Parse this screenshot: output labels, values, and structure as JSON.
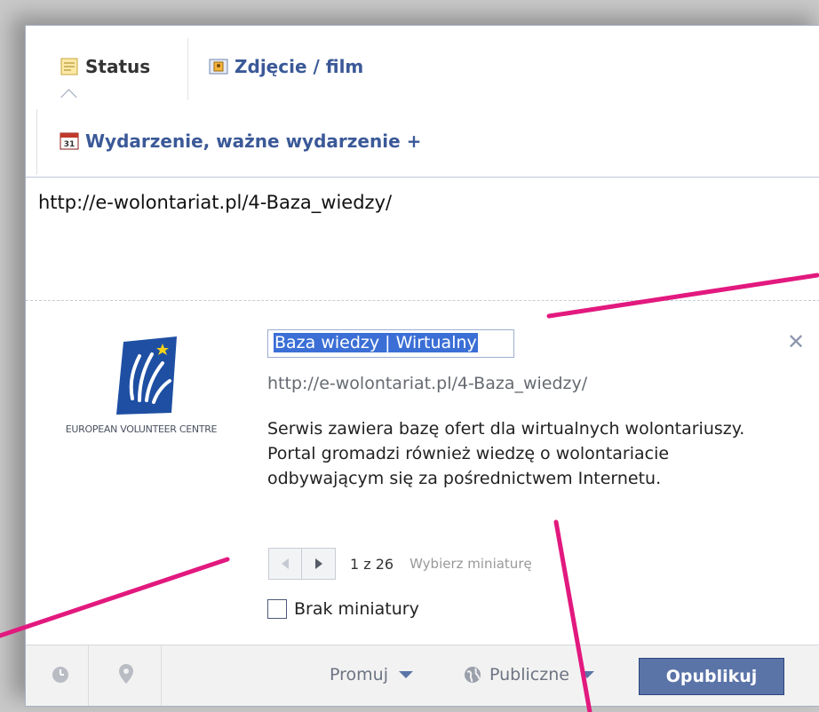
{
  "tabs": {
    "status": "Status",
    "photo": "Zdjęcie / film",
    "event": "Wydarzenie, ważne wydarzenie +"
  },
  "event_icon_day": "31",
  "composer": {
    "text": "http://e-wolontariat.pl/4-Baza_wiedzy/"
  },
  "attachment": {
    "thumbnail_caption": "EUROPEAN VOLUNTEER CENTRE",
    "title": "Baza wiedzy | Wirtualny",
    "url": "http://e-wolontariat.pl/4-Baza_wiedzy/",
    "description": "Serwis zawiera bazę ofert dla wirtualnych wolontariuszy. Portal gromadzi również wiedzę o wolontariacie odbywającym się za pośrednictwem Internetu.",
    "pager": {
      "count": "1 z 26",
      "hint": "Wybierz miniaturę"
    },
    "no_thumbnail_label": "Brak miniatury"
  },
  "footer": {
    "promote": "Promuj",
    "audience": "Publiczne",
    "publish": "Opublikuj"
  },
  "colors": {
    "brand_blue": "#3b5998",
    "button_blue": "#5b74a8",
    "annotation_pink": "#e2197e",
    "selection": "#3b6fd6"
  },
  "icons": [
    "status-icon",
    "photo-icon",
    "calendar-icon",
    "close-icon",
    "prev-arrow-icon",
    "next-arrow-icon",
    "clock-icon",
    "location-pin-icon",
    "globe-icon",
    "chevron-down-icon"
  ]
}
